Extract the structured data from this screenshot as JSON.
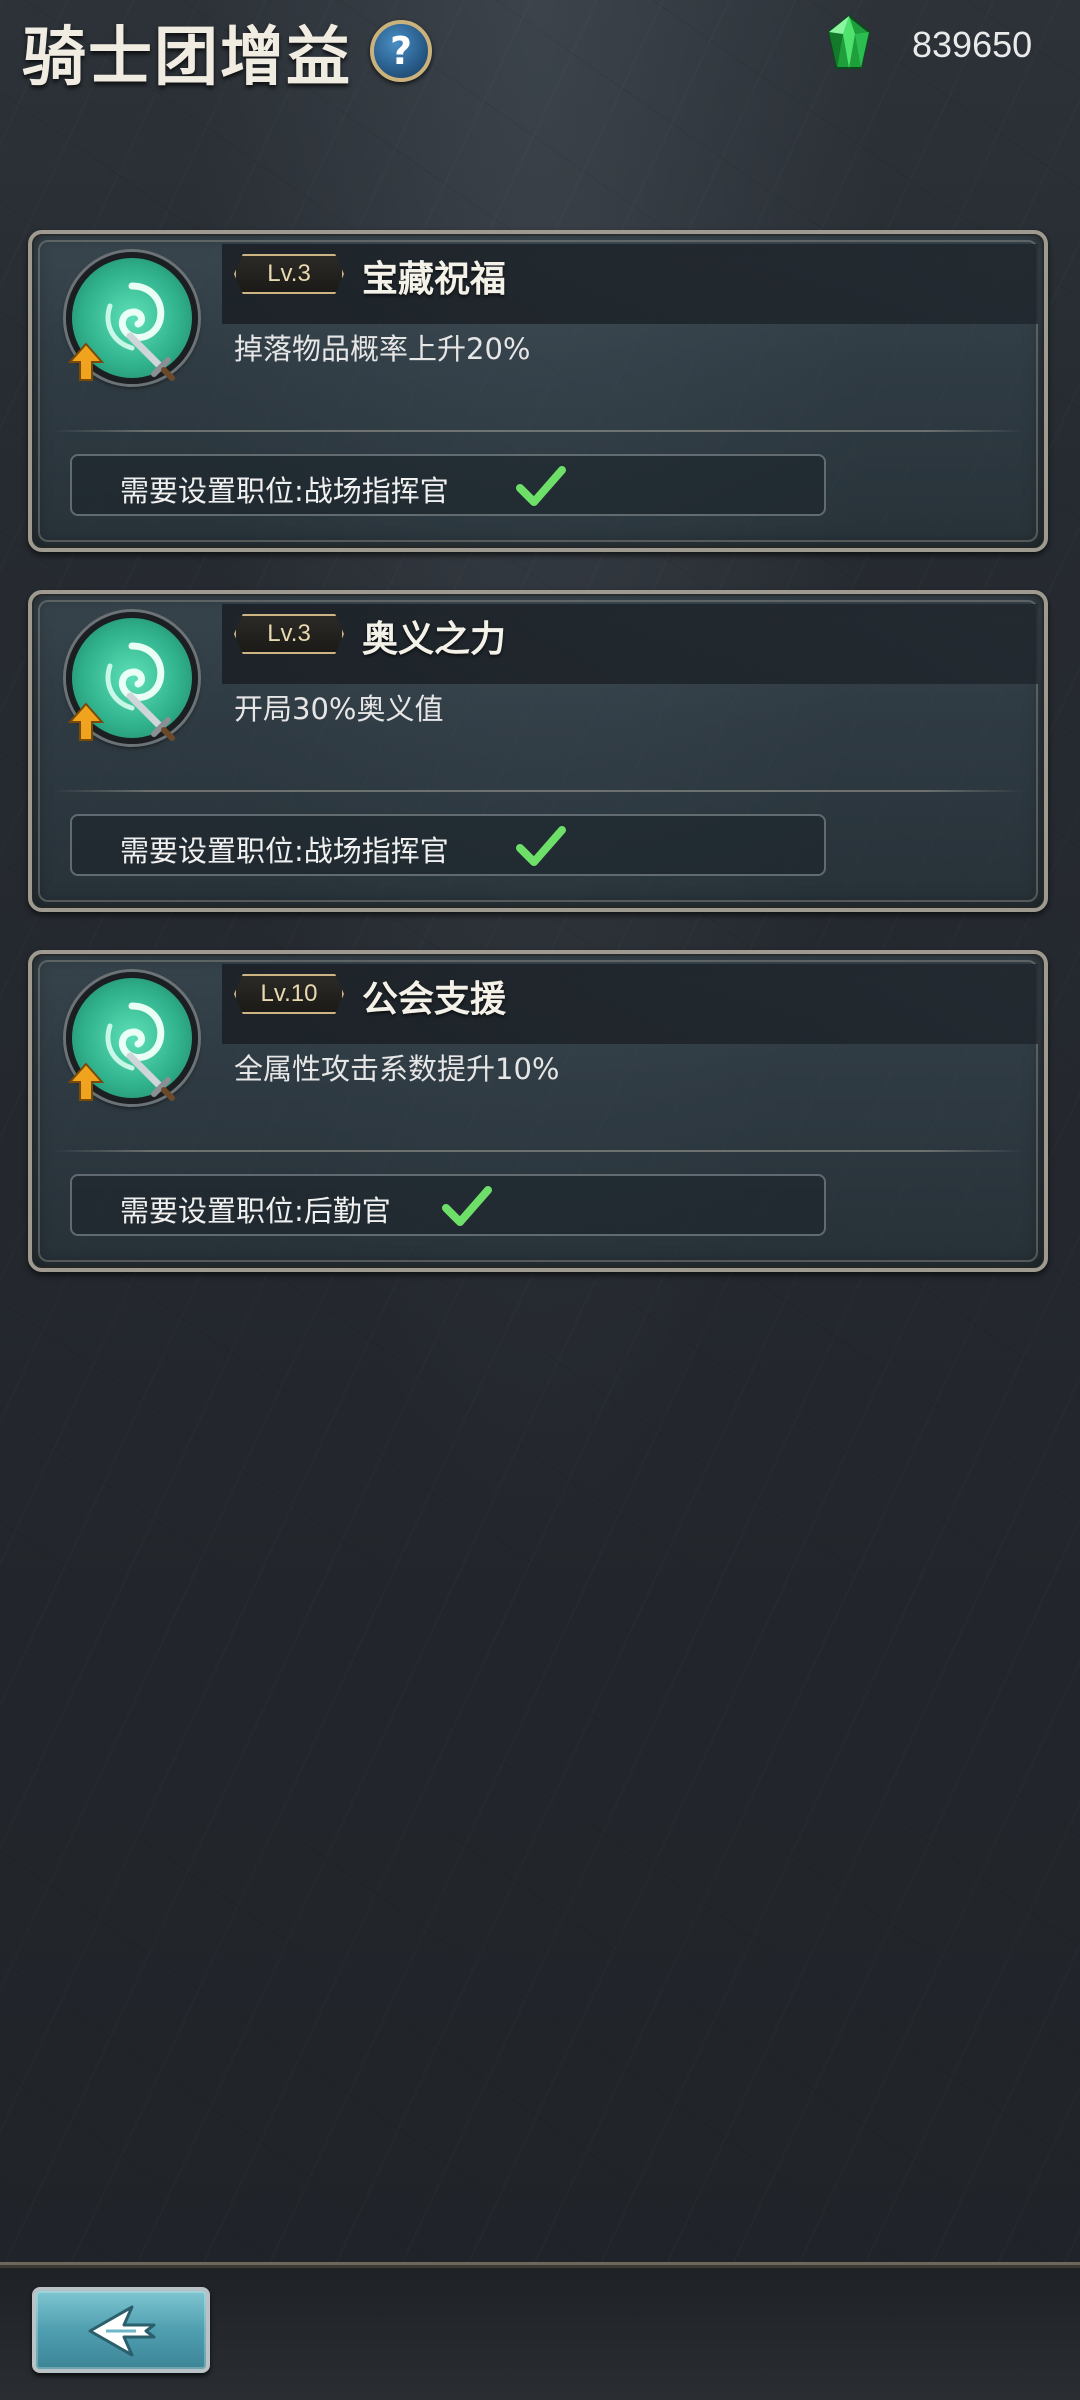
{
  "header": {
    "title": "骑士团增益",
    "help_label": "?",
    "currency": {
      "icon": "green-gem-icon",
      "value": "839650"
    }
  },
  "buffs": [
    {
      "level": "Lv.3",
      "name": "宝藏祝福",
      "description": "掉落物品概率上升20%",
      "requirement": "需要设置职位:战场指挥官",
      "satisfied": true
    },
    {
      "level": "Lv.3",
      "name": "奥义之力",
      "description": "开局30%奥义值",
      "requirement": "需要设置职位:战场指挥官",
      "satisfied": true
    },
    {
      "level": "Lv.10",
      "name": "公会支援",
      "description": "全属性攻击系数提升10%",
      "requirement": "需要设置职位:后勤官",
      "satisfied": true
    }
  ],
  "footer": {
    "back_icon": "back-arrow-icon"
  },
  "colors": {
    "accent_gold": "#cdb483",
    "check_green": "#6ee06a",
    "skill_teal": "#31b48e"
  }
}
